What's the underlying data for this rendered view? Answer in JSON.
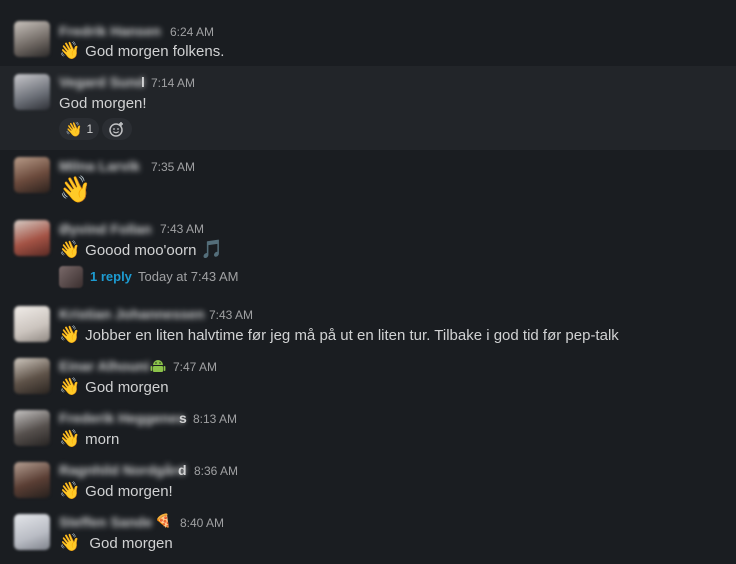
{
  "messages": [
    {
      "name": "Fredrik Hansen",
      "time": "6:24 AM",
      "text": "God morgen folkens.",
      "emoji": "👋"
    },
    {
      "name": "Vegard Sund",
      "name_tail": "l",
      "time": "7:14 AM",
      "text": "God morgen!",
      "reaction_emoji": "👋",
      "reaction_count": "1"
    },
    {
      "name": "Milna Larvik",
      "time": "7:35 AM",
      "emoji": "👋"
    },
    {
      "name": "Øyvind Follan",
      "time": "7:43 AM",
      "text": "Goood moo'oorn",
      "emoji": "👋",
      "music_emoji": "🎵",
      "reply_count": "1 reply",
      "reply_time": "Today at 7:43 AM"
    },
    {
      "name": "Kristian Johannessen",
      "time": "7:43 AM",
      "text": "Jobber en liten halvtime før jeg må på ut en liten tur. Tilbake i god tid før pep-talk",
      "emoji": "👋"
    },
    {
      "name": "Einar Alhouni",
      "time": "7:47 AM",
      "text": "God morgen",
      "emoji": "👋",
      "status_icon": "android-icon"
    },
    {
      "name": "Frederik Heggenes",
      "name_tail": "s",
      "time": "8:13 AM",
      "text": "morn",
      "emoji": "👋"
    },
    {
      "name": "Ragnhild Nordgård",
      "name_tail": "d",
      "time": "8:36 AM",
      "text": "God morgen!",
      "emoji": "👋"
    },
    {
      "name": "Steffen Sande",
      "time": "8:40 AM",
      "text": "God morgen",
      "emoji": "👋",
      "status_emoji": "🍕"
    }
  ]
}
